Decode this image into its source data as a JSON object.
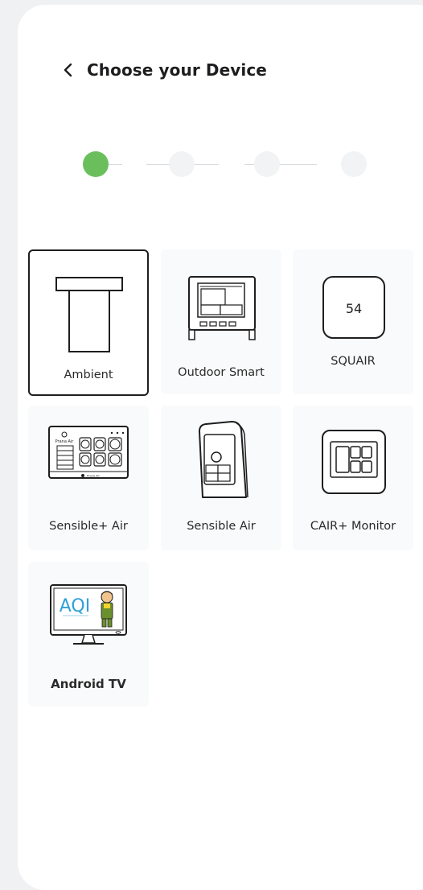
{
  "header": {
    "back_icon": "chevron-left-icon",
    "title": "Choose your Device"
  },
  "stepper": {
    "total_steps": 4,
    "current_step": 1,
    "active_color": "#6abf5c",
    "inactive_color": "#f1f3f5"
  },
  "devices": [
    {
      "label": "Ambient",
      "icon": "ambient-device-icon",
      "selected": true
    },
    {
      "label": "Outdoor Smart",
      "icon": "outdoor-smart-device-icon",
      "selected": false
    },
    {
      "label": "SQUAIR",
      "icon": "squair-device-icon",
      "icon_text": "54",
      "selected": false
    },
    {
      "label": "Sensible+ Air",
      "icon": "sensible-plus-air-device-icon",
      "icon_text": "Prana Air",
      "selected": false
    },
    {
      "label": "Sensible Air",
      "icon": "sensible-air-device-icon",
      "selected": false
    },
    {
      "label": "CAIR+ Monitor",
      "icon": "cair-plus-monitor-device-icon",
      "selected": false
    },
    {
      "label": "Android TV",
      "icon": "android-tv-device-icon",
      "icon_text": "AQI",
      "selected": false
    }
  ],
  "colors": {
    "selected_border": "#1e1e1e",
    "tile_background": "#f9fafb"
  }
}
